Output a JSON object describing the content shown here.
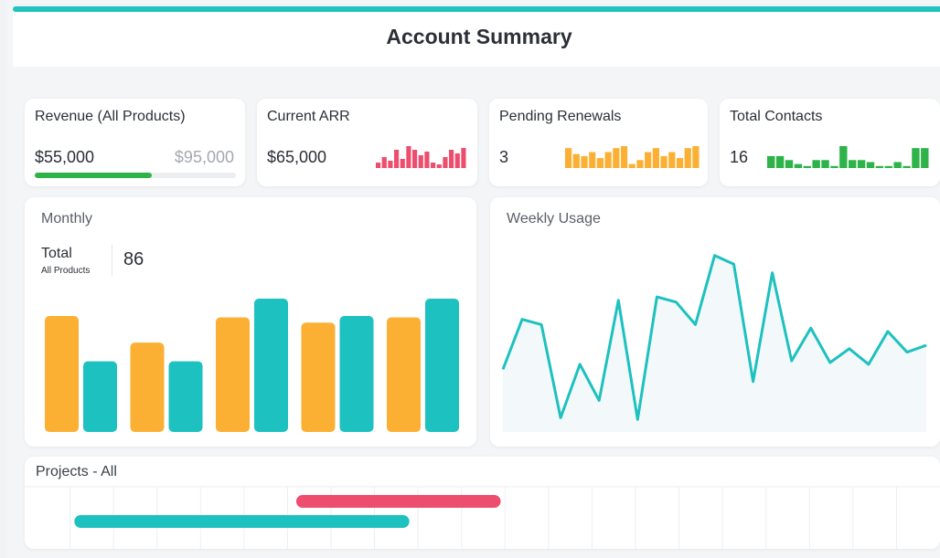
{
  "page": {
    "title": "Account Summary"
  },
  "colors": {
    "accent": "#20c3bd",
    "orange": "#fbb034",
    "teal": "#1dc1bf",
    "pink": "#ee4e6e",
    "green": "#2eb349",
    "progress_green": "#2eb349"
  },
  "kpis": {
    "revenue": {
      "title": "Revenue (All Products)",
      "value": "$55,000",
      "target": "$95,000",
      "progress": 0.58
    },
    "arr": {
      "title": "Current ARR",
      "value": "$65,000",
      "spark": [
        3,
        6,
        4,
        10,
        5,
        12,
        10,
        7,
        9,
        3,
        2,
        6,
        10,
        8,
        11
      ]
    },
    "renewals": {
      "title": "Pending Renewals",
      "value": "3",
      "spark": [
        10,
        7,
        6,
        8,
        5,
        8,
        10,
        11,
        2,
        4,
        8,
        10,
        6,
        8,
        5,
        10,
        11
      ]
    },
    "contacts": {
      "title": "Total Contacts",
      "value": "16",
      "spark": [
        6,
        6,
        4,
        2,
        1,
        4,
        4,
        1,
        11,
        4,
        4,
        3,
        1,
        1,
        3,
        1,
        10,
        10
      ]
    }
  },
  "monthly": {
    "title": "Monthly",
    "total_label": "Total",
    "total_sub": "All Products",
    "total_value": "86",
    "chart_data": {
      "type": "bar",
      "categories": [
        "",
        "",
        "",
        "",
        ""
      ],
      "ylim": [
        0,
        100
      ],
      "series": [
        {
          "color": "#fbb034",
          "values": [
            87,
            67,
            86,
            82,
            86
          ]
        },
        {
          "color": "#1dc1bf",
          "values": [
            53,
            53,
            100,
            87,
            100
          ]
        }
      ]
    }
  },
  "weekly": {
    "title": "Weekly Usage",
    "chart_data": {
      "type": "area",
      "ylim": [
        0,
        100
      ],
      "values": [
        32,
        61,
        58,
        4,
        35,
        14,
        72,
        3,
        74,
        71,
        58,
        98,
        93,
        25,
        88,
        37,
        56,
        36,
        44,
        35,
        54,
        42,
        46
      ]
    }
  },
  "projects": {
    "title": "Projects - All",
    "columns": 21,
    "bars": [
      {
        "color": "#ee4e6e",
        "start": 6.2,
        "end": 10.9,
        "row": 0
      },
      {
        "color": "#1dc1bf",
        "start": 1.1,
        "end": 8.8,
        "row": 1
      }
    ]
  }
}
